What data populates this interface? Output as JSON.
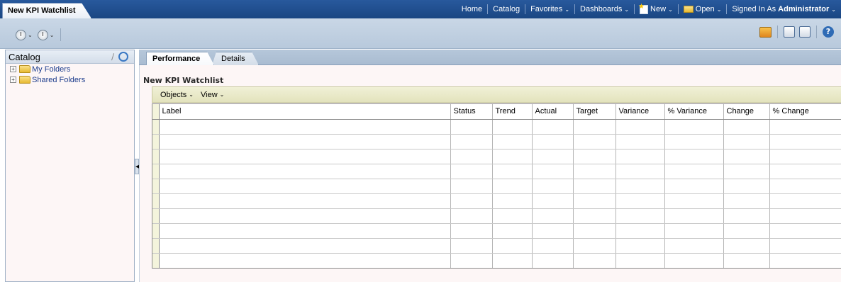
{
  "document_tab": {
    "title": "New KPI Watchlist"
  },
  "global_nav": {
    "home": "Home",
    "catalog": "Catalog",
    "favorites": "Favorites",
    "dashboards": "Dashboards",
    "new": "New",
    "open": "Open",
    "signed_in_as": "Signed In As",
    "user": "Administrator"
  },
  "catalog_pane": {
    "title": "Catalog",
    "tree": [
      {
        "label": "My Folders"
      },
      {
        "label": "Shared Folders"
      }
    ]
  },
  "tabs": [
    {
      "label": "Performance",
      "active": true
    },
    {
      "label": "Details",
      "active": false
    }
  ],
  "main": {
    "title": "New KPI Watchlist",
    "menus": [
      {
        "label": "Objects"
      },
      {
        "label": "View"
      }
    ],
    "columns": [
      "Label",
      "Status",
      "Trend",
      "Actual",
      "Target",
      "Variance",
      "% Variance",
      "Change",
      "% Change"
    ],
    "row_count": 10
  },
  "colors": {
    "topbar": "#1f4f8f",
    "toolbar": "#c0d0e1",
    "pane_bg": "#fdf6f6",
    "menubar": "#e9e9c9"
  },
  "icons": [
    "schedule-icon",
    "history-icon",
    "kpi-icon",
    "save-icon",
    "save-as-icon",
    "help-icon",
    "edit-icon",
    "refresh-icon",
    "folder-icon",
    "expand-icon",
    "new-icon",
    "open-folder-icon"
  ]
}
